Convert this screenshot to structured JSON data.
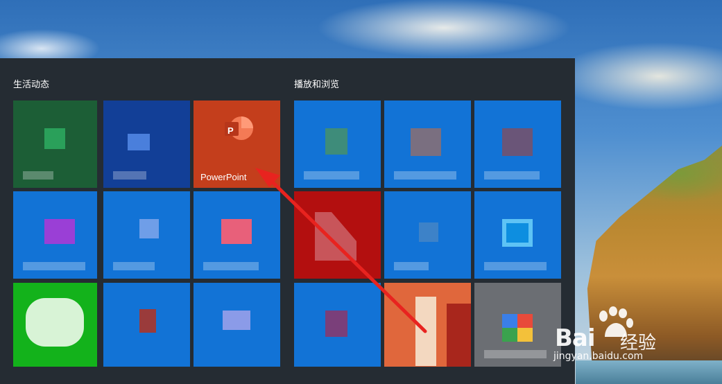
{
  "groups": {
    "left_title": "生活动态",
    "right_title": "播放和浏览"
  },
  "tiles": {
    "powerpoint_label": "PowerPoint",
    "powerpoint_glyph": "P",
    "powerpoint_color": "#c43e1c",
    "tile_blue": "#1273d6",
    "tile_green_dark": "#1c5e36",
    "tile_navy": "#123f97",
    "tile_red": "#b30f0f",
    "tile_green_bright": "#13b21b",
    "tile_orange": "#e0673c",
    "tile_gray": "#6b6e73"
  },
  "watermark": {
    "brand_text": "Bai",
    "brand_suffix": "经验",
    "url": "jingyan.baidu.com"
  },
  "annotation": {
    "arrow_color": "#e8231f",
    "arrow_target": "powerpoint-tile"
  }
}
